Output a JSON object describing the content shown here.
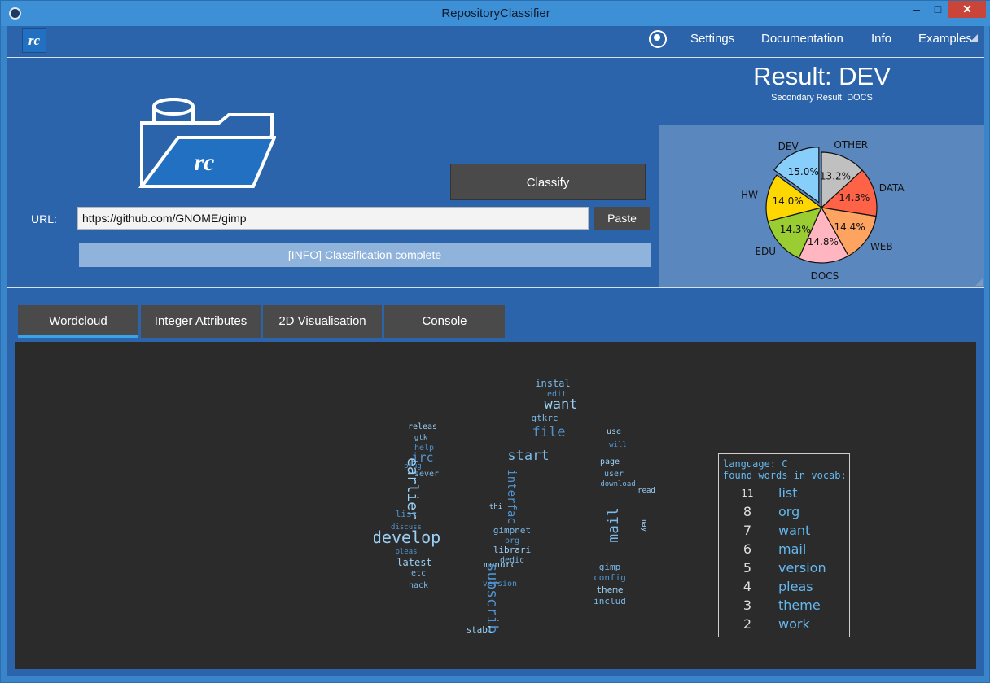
{
  "window": {
    "title": "RepositoryClassifier",
    "minimize": "–",
    "maximize": "□",
    "close": "✕"
  },
  "menubar": {
    "logo": "rc",
    "items": [
      {
        "label": "Settings"
      },
      {
        "label": "Documentation"
      },
      {
        "label": "Info"
      },
      {
        "label": "Examples"
      }
    ]
  },
  "classify": {
    "button_label": "Classify",
    "url_label": "URL:",
    "url_value": "https://github.com/GNOME/gimp",
    "paste_label": "Paste",
    "status_text": "[INFO] Classification complete"
  },
  "result": {
    "title": "Result: DEV",
    "secondary": "Secondary Result: DOCS"
  },
  "chart_data": {
    "type": "pie",
    "categories": [
      "DEV",
      "OTHER",
      "DATA",
      "WEB",
      "DOCS",
      "EDU",
      "HW"
    ],
    "values": [
      15.0,
      13.2,
      14.3,
      14.4,
      14.8,
      14.3,
      14.0
    ],
    "labels": [
      "15.0%",
      "13.2%",
      "14.3%",
      "14.4%",
      "14.8%",
      "14.3%",
      "14.0%"
    ],
    "colors": [
      "#87cefa",
      "#c0c0c0",
      "#ff6347",
      "#ffa460",
      "#ffb6c1",
      "#9acd32",
      "#ffd700"
    ],
    "exploded": "DEV",
    "title": ""
  },
  "tabs": [
    {
      "label": "Wordcloud",
      "active": true
    },
    {
      "label": "Integer Attributes",
      "active": false
    },
    {
      "label": "2D Visualisation",
      "active": false
    },
    {
      "label": "Console",
      "active": false
    }
  ],
  "wordcloud_words": [
    "instal",
    "edit",
    "want",
    "gtkrc",
    "file",
    "releas",
    "gtk",
    "help",
    "use",
    "start",
    "irc",
    "page",
    "user",
    "interfac",
    "earlier",
    "mail",
    "list",
    "develop",
    "gimpnet",
    "org",
    "librari",
    "dedic",
    "pleas",
    "latest",
    "etc",
    "version",
    "menurc",
    "hack",
    "subscrib",
    "stabl",
    "gimp",
    "config",
    "theme",
    "includ",
    "plug",
    "read",
    "download",
    "will",
    "may",
    "sever",
    "discuss",
    "thi"
  ],
  "vocab": {
    "language": "language: C",
    "found": "found words in vocab:",
    "rows": [
      {
        "count": "11",
        "word": "list"
      },
      {
        "count": "8",
        "word": "org"
      },
      {
        "count": "7",
        "word": "want"
      },
      {
        "count": "6",
        "word": "mail"
      },
      {
        "count": "5",
        "word": "version"
      },
      {
        "count": "4",
        "word": "pleas"
      },
      {
        "count": "3",
        "word": "theme"
      },
      {
        "count": "2",
        "word": "work"
      }
    ]
  }
}
